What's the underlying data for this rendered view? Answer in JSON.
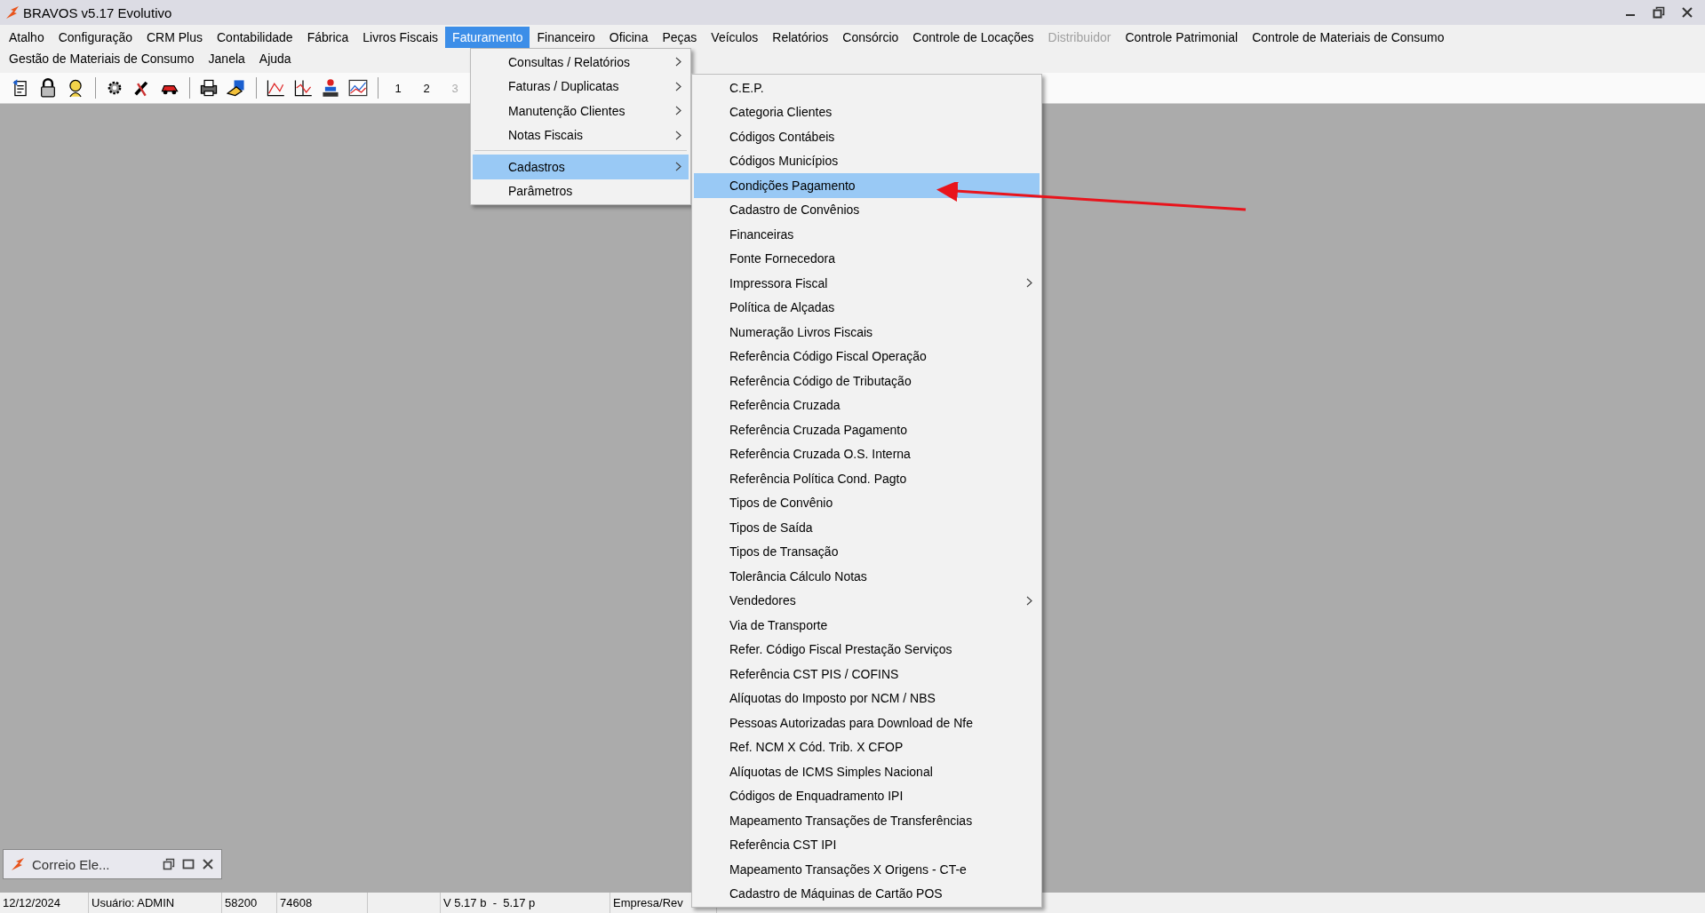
{
  "window": {
    "title": "BRAVOS v5.17 Evolutivo"
  },
  "menu_bar": {
    "first_row": [
      {
        "label": "Atalho",
        "selected": false,
        "disabled": false
      },
      {
        "label": "Configuração",
        "selected": false,
        "disabled": false
      },
      {
        "label": "CRM Plus",
        "selected": false,
        "disabled": false
      },
      {
        "label": "Contabilidade",
        "selected": false,
        "disabled": false
      },
      {
        "label": "Fábrica",
        "selected": false,
        "disabled": false
      },
      {
        "label": "Livros Fiscais",
        "selected": false,
        "disabled": false
      },
      {
        "label": "Faturamento",
        "selected": true,
        "disabled": false
      },
      {
        "label": "Financeiro",
        "selected": false,
        "disabled": false
      },
      {
        "label": "Oficina",
        "selected": false,
        "disabled": false
      },
      {
        "label": "Peças",
        "selected": false,
        "disabled": false
      },
      {
        "label": "Veículos",
        "selected": false,
        "disabled": false
      },
      {
        "label": "Relatórios",
        "selected": false,
        "disabled": false
      },
      {
        "label": "Consórcio",
        "selected": false,
        "disabled": false
      },
      {
        "label": "Controle de Locações",
        "selected": false,
        "disabled": false
      },
      {
        "label": "Distribuidor",
        "selected": false,
        "disabled": true
      },
      {
        "label": "Controle Patrimonial",
        "selected": false,
        "disabled": false
      },
      {
        "label": "Controle de Materiais de Consumo",
        "selected": false,
        "disabled": false
      }
    ],
    "second_row": [
      {
        "label": "Gestão de Materiais de Consumo",
        "selected": false,
        "disabled": false
      },
      {
        "label": "Janela",
        "selected": false,
        "disabled": false
      },
      {
        "label": "Ajuda",
        "selected": false,
        "disabled": false
      }
    ]
  },
  "toolbar": {
    "number_buttons": [
      {
        "label": "1",
        "disabled": false
      },
      {
        "label": "2",
        "disabled": false
      },
      {
        "label": "3",
        "disabled": true
      }
    ]
  },
  "dropdown_menu": {
    "items": [
      {
        "label": "Consultas / Relatórios",
        "has_submenu": true,
        "selected": false
      },
      {
        "label": "Faturas / Duplicatas",
        "has_submenu": true,
        "selected": false
      },
      {
        "label": "Manutenção Clientes",
        "has_submenu": true,
        "selected": false
      },
      {
        "label": "Notas Fiscais",
        "has_submenu": true,
        "selected": false,
        "separator_after": true
      },
      {
        "label": "Cadastros",
        "has_submenu": true,
        "selected": true
      },
      {
        "label": "Parâmetros",
        "has_submenu": false,
        "selected": false
      }
    ]
  },
  "submenu": {
    "items": [
      {
        "label": "C.E.P.",
        "has_submenu": false,
        "selected": false
      },
      {
        "label": "Categoria Clientes",
        "has_submenu": false,
        "selected": false
      },
      {
        "label": "Códigos Contábeis",
        "has_submenu": false,
        "selected": false
      },
      {
        "label": "Códigos Municípios",
        "has_submenu": false,
        "selected": false
      },
      {
        "label": "Condições Pagamento",
        "has_submenu": false,
        "selected": true
      },
      {
        "label": "Cadastro de Convênios",
        "has_submenu": false,
        "selected": false
      },
      {
        "label": "Financeiras",
        "has_submenu": false,
        "selected": false
      },
      {
        "label": "Fonte Fornecedora",
        "has_submenu": false,
        "selected": false
      },
      {
        "label": "Impressora Fiscal",
        "has_submenu": true,
        "selected": false
      },
      {
        "label": "Política de Alçadas",
        "has_submenu": false,
        "selected": false
      },
      {
        "label": "Numeração Livros Fiscais",
        "has_submenu": false,
        "selected": false
      },
      {
        "label": "Referência Código Fiscal Operação",
        "has_submenu": false,
        "selected": false
      },
      {
        "label": "Referência Código de Tributação",
        "has_submenu": false,
        "selected": false
      },
      {
        "label": "Referência Cruzada",
        "has_submenu": false,
        "selected": false
      },
      {
        "label": "Referência Cruzada Pagamento",
        "has_submenu": false,
        "selected": false
      },
      {
        "label": "Referência Cruzada O.S. Interna",
        "has_submenu": false,
        "selected": false
      },
      {
        "label": "Referência Política Cond. Pagto",
        "has_submenu": false,
        "selected": false
      },
      {
        "label": "Tipos de Convênio",
        "has_submenu": false,
        "selected": false
      },
      {
        "label": "Tipos de Saída",
        "has_submenu": false,
        "selected": false
      },
      {
        "label": "Tipos de Transação",
        "has_submenu": false,
        "selected": false
      },
      {
        "label": "Tolerância Cálculo Notas",
        "has_submenu": false,
        "selected": false
      },
      {
        "label": "Vendedores",
        "has_submenu": true,
        "selected": false
      },
      {
        "label": "Via de Transporte",
        "has_submenu": false,
        "selected": false
      },
      {
        "label": "Refer. Código Fiscal Prestação Serviços",
        "has_submenu": false,
        "selected": false
      },
      {
        "label": "Referência CST PIS / COFINS",
        "has_submenu": false,
        "selected": false
      },
      {
        "label": "Alíquotas do Imposto por NCM / NBS",
        "has_submenu": false,
        "selected": false
      },
      {
        "label": "Pessoas Autorizadas para Download de Nfe",
        "has_submenu": false,
        "selected": false
      },
      {
        "label": "Ref. NCM X Cód. Trib. X CFOP",
        "has_submenu": false,
        "selected": false
      },
      {
        "label": "Alíquotas de ICMS Simples Nacional",
        "has_submenu": false,
        "selected": false
      },
      {
        "label": "Códigos de Enquadramento IPI",
        "has_submenu": false,
        "selected": false
      },
      {
        "label": "Mapeamento Transações de Transferências",
        "has_submenu": false,
        "selected": false
      },
      {
        "label": "Referência CST IPI",
        "has_submenu": false,
        "selected": false
      },
      {
        "label": "Mapeamento Transações X Origens - CT-e",
        "has_submenu": false,
        "selected": false
      },
      {
        "label": "Cadastro de Máquinas de Cartão POS",
        "has_submenu": false,
        "selected": false
      }
    ]
  },
  "minimized_window": {
    "title": "Correio Ele..."
  },
  "status_bar": {
    "cells": [
      "12/12/2024",
      "Usuário: ADMIN",
      "58200",
      "74608",
      "",
      "V 5.17 b  -  5.17 p",
      "Empresa/Rev"
    ]
  }
}
